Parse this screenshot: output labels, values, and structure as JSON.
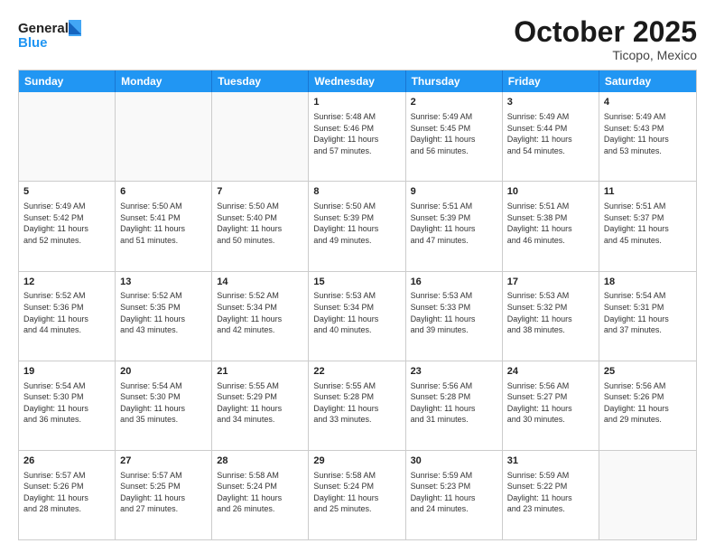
{
  "logo": {
    "line1": "General",
    "line2": "Blue"
  },
  "title": "October 2025",
  "location": "Ticopo, Mexico",
  "header_days": [
    "Sunday",
    "Monday",
    "Tuesday",
    "Wednesday",
    "Thursday",
    "Friday",
    "Saturday"
  ],
  "weeks": [
    [
      {
        "day": "",
        "text": "",
        "empty": true
      },
      {
        "day": "",
        "text": "",
        "empty": true
      },
      {
        "day": "",
        "text": "",
        "empty": true
      },
      {
        "day": "1",
        "text": "Sunrise: 5:48 AM\nSunset: 5:46 PM\nDaylight: 11 hours\nand 57 minutes.",
        "empty": false
      },
      {
        "day": "2",
        "text": "Sunrise: 5:49 AM\nSunset: 5:45 PM\nDaylight: 11 hours\nand 56 minutes.",
        "empty": false
      },
      {
        "day": "3",
        "text": "Sunrise: 5:49 AM\nSunset: 5:44 PM\nDaylight: 11 hours\nand 54 minutes.",
        "empty": false
      },
      {
        "day": "4",
        "text": "Sunrise: 5:49 AM\nSunset: 5:43 PM\nDaylight: 11 hours\nand 53 minutes.",
        "empty": false
      }
    ],
    [
      {
        "day": "5",
        "text": "Sunrise: 5:49 AM\nSunset: 5:42 PM\nDaylight: 11 hours\nand 52 minutes.",
        "empty": false
      },
      {
        "day": "6",
        "text": "Sunrise: 5:50 AM\nSunset: 5:41 PM\nDaylight: 11 hours\nand 51 minutes.",
        "empty": false
      },
      {
        "day": "7",
        "text": "Sunrise: 5:50 AM\nSunset: 5:40 PM\nDaylight: 11 hours\nand 50 minutes.",
        "empty": false
      },
      {
        "day": "8",
        "text": "Sunrise: 5:50 AM\nSunset: 5:39 PM\nDaylight: 11 hours\nand 49 minutes.",
        "empty": false
      },
      {
        "day": "9",
        "text": "Sunrise: 5:51 AM\nSunset: 5:39 PM\nDaylight: 11 hours\nand 47 minutes.",
        "empty": false
      },
      {
        "day": "10",
        "text": "Sunrise: 5:51 AM\nSunset: 5:38 PM\nDaylight: 11 hours\nand 46 minutes.",
        "empty": false
      },
      {
        "day": "11",
        "text": "Sunrise: 5:51 AM\nSunset: 5:37 PM\nDaylight: 11 hours\nand 45 minutes.",
        "empty": false
      }
    ],
    [
      {
        "day": "12",
        "text": "Sunrise: 5:52 AM\nSunset: 5:36 PM\nDaylight: 11 hours\nand 44 minutes.",
        "empty": false
      },
      {
        "day": "13",
        "text": "Sunrise: 5:52 AM\nSunset: 5:35 PM\nDaylight: 11 hours\nand 43 minutes.",
        "empty": false
      },
      {
        "day": "14",
        "text": "Sunrise: 5:52 AM\nSunset: 5:34 PM\nDaylight: 11 hours\nand 42 minutes.",
        "empty": false
      },
      {
        "day": "15",
        "text": "Sunrise: 5:53 AM\nSunset: 5:34 PM\nDaylight: 11 hours\nand 40 minutes.",
        "empty": false
      },
      {
        "day": "16",
        "text": "Sunrise: 5:53 AM\nSunset: 5:33 PM\nDaylight: 11 hours\nand 39 minutes.",
        "empty": false
      },
      {
        "day": "17",
        "text": "Sunrise: 5:53 AM\nSunset: 5:32 PM\nDaylight: 11 hours\nand 38 minutes.",
        "empty": false
      },
      {
        "day": "18",
        "text": "Sunrise: 5:54 AM\nSunset: 5:31 PM\nDaylight: 11 hours\nand 37 minutes.",
        "empty": false
      }
    ],
    [
      {
        "day": "19",
        "text": "Sunrise: 5:54 AM\nSunset: 5:30 PM\nDaylight: 11 hours\nand 36 minutes.",
        "empty": false
      },
      {
        "day": "20",
        "text": "Sunrise: 5:54 AM\nSunset: 5:30 PM\nDaylight: 11 hours\nand 35 minutes.",
        "empty": false
      },
      {
        "day": "21",
        "text": "Sunrise: 5:55 AM\nSunset: 5:29 PM\nDaylight: 11 hours\nand 34 minutes.",
        "empty": false
      },
      {
        "day": "22",
        "text": "Sunrise: 5:55 AM\nSunset: 5:28 PM\nDaylight: 11 hours\nand 33 minutes.",
        "empty": false
      },
      {
        "day": "23",
        "text": "Sunrise: 5:56 AM\nSunset: 5:28 PM\nDaylight: 11 hours\nand 31 minutes.",
        "empty": false
      },
      {
        "day": "24",
        "text": "Sunrise: 5:56 AM\nSunset: 5:27 PM\nDaylight: 11 hours\nand 30 minutes.",
        "empty": false
      },
      {
        "day": "25",
        "text": "Sunrise: 5:56 AM\nSunset: 5:26 PM\nDaylight: 11 hours\nand 29 minutes.",
        "empty": false
      }
    ],
    [
      {
        "day": "26",
        "text": "Sunrise: 5:57 AM\nSunset: 5:26 PM\nDaylight: 11 hours\nand 28 minutes.",
        "empty": false
      },
      {
        "day": "27",
        "text": "Sunrise: 5:57 AM\nSunset: 5:25 PM\nDaylight: 11 hours\nand 27 minutes.",
        "empty": false
      },
      {
        "day": "28",
        "text": "Sunrise: 5:58 AM\nSunset: 5:24 PM\nDaylight: 11 hours\nand 26 minutes.",
        "empty": false
      },
      {
        "day": "29",
        "text": "Sunrise: 5:58 AM\nSunset: 5:24 PM\nDaylight: 11 hours\nand 25 minutes.",
        "empty": false
      },
      {
        "day": "30",
        "text": "Sunrise: 5:59 AM\nSunset: 5:23 PM\nDaylight: 11 hours\nand 24 minutes.",
        "empty": false
      },
      {
        "day": "31",
        "text": "Sunrise: 5:59 AM\nSunset: 5:22 PM\nDaylight: 11 hours\nand 23 minutes.",
        "empty": false
      },
      {
        "day": "",
        "text": "",
        "empty": true
      }
    ]
  ]
}
